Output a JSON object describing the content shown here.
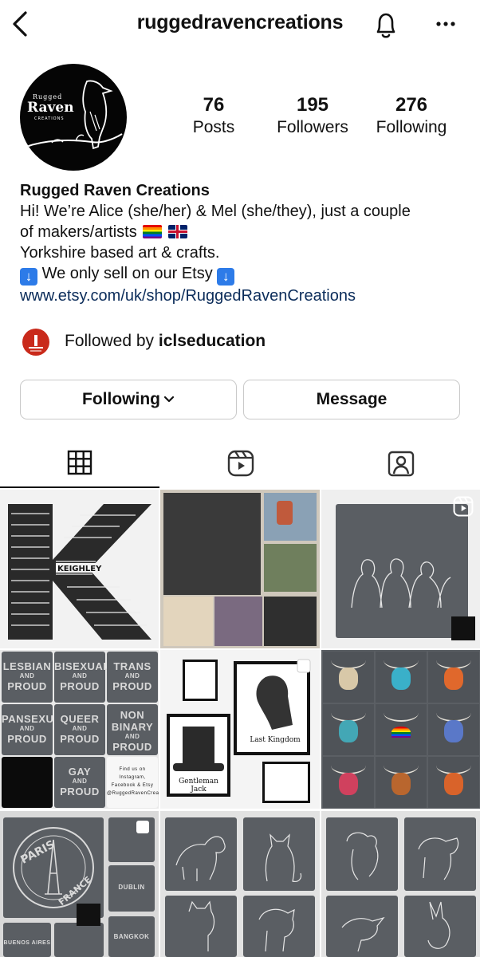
{
  "header": {
    "username": "ruggedravencreations",
    "icons": {
      "back": "chevron-left-icon",
      "notifications": "bell-icon",
      "more": "more-horizontal-icon"
    }
  },
  "profile": {
    "avatar": {
      "brand_top": "Rugged",
      "brand_main": "Raven",
      "brand_sub": "CREATIONS"
    },
    "stats": [
      {
        "value": "76",
        "label": "Posts"
      },
      {
        "value": "195",
        "label": "Followers"
      },
      {
        "value": "276",
        "label": "Following"
      }
    ],
    "name": "Rugged Raven Creations",
    "bio": {
      "line1": "Hi! We’re Alice (she/her) & Mel (she/they), just a couple",
      "line2": "of makers/artists",
      "line3": "Yorkshire based art & crafts.",
      "line4": "We only sell on our Etsy",
      "link": "www.etsy.com/uk/shop/RuggedRavenCreations"
    },
    "followed_by": {
      "prefix": "Followed by",
      "account": "iclseducation"
    }
  },
  "actions": {
    "following": "Following",
    "message": "Message"
  },
  "tabs": [
    "grid-icon",
    "reels-icon",
    "tagged-icon"
  ],
  "grid": {
    "posts": [
      {
        "id": "p1",
        "kind": "word-art-K",
        "text": "KEIGHLEY"
      },
      {
        "id": "p2",
        "kind": "market-stall"
      },
      {
        "id": "p3",
        "kind": "slate-line-drawing",
        "reel": true
      },
      {
        "id": "p4",
        "kind": "pride-slates",
        "labels": [
          [
            "LESBIAN",
            "AND",
            "PROUD"
          ],
          [
            "BISEXUAL",
            "AND",
            "PROUD"
          ],
          [
            "TRANS",
            "AND",
            "PROUD"
          ],
          [
            "PANSEXUAL",
            "AND",
            "PROUD"
          ],
          [
            "QUEER",
            "AND",
            "PROUD"
          ],
          [
            "NON",
            "BINARY",
            "AND",
            "PROUD"
          ],
          [
            "",
            ""
          ],
          [
            "GAY",
            "AND",
            "PROUD"
          ],
          [
            "Find us on",
            "Instagram, Facebook & Etsy",
            "@RuggedRavenCreations"
          ]
        ]
      },
      {
        "id": "p5",
        "kind": "framed-prints",
        "captions": [
          "Last Kingdom",
          "Gentleman Jack"
        ]
      },
      {
        "id": "p6",
        "kind": "pendants"
      },
      {
        "id": "p7",
        "kind": "paris-slates",
        "labels": [
          "PARIS",
          "FRANCE",
          "DUBLIN",
          "BUENOS AIRES",
          "BANGKOK"
        ],
        "multiple": true
      },
      {
        "id": "p8",
        "kind": "pet-slates"
      },
      {
        "id": "p9",
        "kind": "pet-slates-2"
      }
    ]
  },
  "colors": {
    "link": "#0b2c5a",
    "border": "#c9c9c9",
    "slate": "#5a5e63",
    "etsy_arrow": "#2d7be8"
  }
}
